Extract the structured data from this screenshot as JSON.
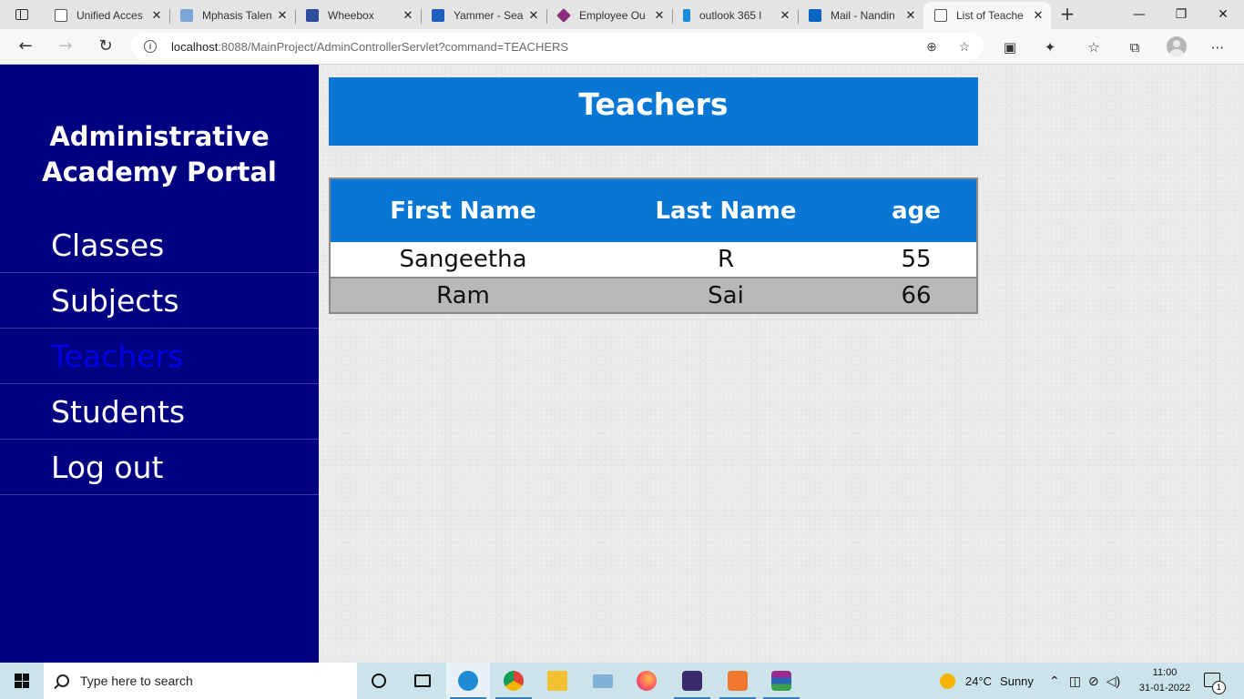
{
  "browser": {
    "tabs": [
      {
        "title": "Unified Acces",
        "favicon": "document-icon",
        "active": false
      },
      {
        "title": "Mphasis Talen",
        "favicon": "mphasis-icon",
        "active": false
      },
      {
        "title": "Wheebox",
        "favicon": "wheebox-icon",
        "active": false
      },
      {
        "title": "Yammer - Sea",
        "favicon": "yammer-icon",
        "active": false
      },
      {
        "title": "Employee Ou",
        "favicon": "powerapps-icon",
        "active": false
      },
      {
        "title": "outlook 365 l",
        "favicon": "bing-icon",
        "active": false
      },
      {
        "title": "Mail - Nandin",
        "favicon": "outlook-icon",
        "active": false
      },
      {
        "title": "List of Teache",
        "favicon": "document-icon",
        "active": true
      }
    ],
    "url_host": "localhost",
    "url_path": ":8088/MainProject/AdminControllerServlet?command=TEACHERS"
  },
  "sidebar": {
    "brand_line1": "Administrative",
    "brand_line2": "Academy Portal",
    "items": [
      {
        "label": "Classes",
        "active": false
      },
      {
        "label": "Subjects",
        "active": false
      },
      {
        "label": "Teachers",
        "active": true
      },
      {
        "label": "Students",
        "active": false
      },
      {
        "label": "Log out",
        "active": false
      }
    ]
  },
  "main": {
    "heading": "Teachers",
    "table": {
      "columns": [
        "First Name",
        "Last Name",
        "age"
      ],
      "rows": [
        [
          "Sangeetha",
          "R",
          "55"
        ],
        [
          "Ram",
          "Sai",
          "66"
        ]
      ]
    }
  },
  "taskbar": {
    "search_placeholder": "Type here to search",
    "weather_temp": "24°C",
    "weather_text": "Sunny",
    "time": "11:00",
    "date": "31-01-2022",
    "notification_count": "1"
  },
  "colors": {
    "sidebar_bg": "#000080",
    "header_blue": "#0776d4",
    "active_nav": "#0000e8",
    "row_alt": "#b8b8b8"
  }
}
